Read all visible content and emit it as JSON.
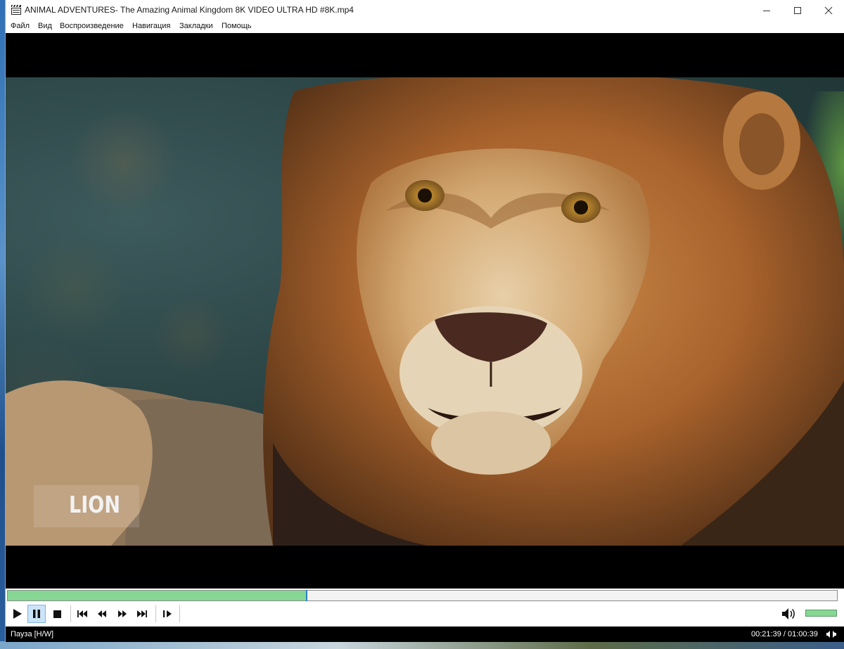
{
  "window": {
    "title": "ANIMAL ADVENTURES- The Amazing Animal Kingdom 8K VIDEO ULTRA HD #8K.mp4"
  },
  "menu": {
    "items": [
      "Файл",
      "Вид",
      "Воспроизведение",
      "Навигация",
      "Закладки",
      "Помощь"
    ]
  },
  "video": {
    "caption": "LION"
  },
  "playback": {
    "progress": 0.36,
    "volume": 1.0
  },
  "controls": {
    "icons": [
      "play-icon",
      "pause-icon",
      "stop-icon",
      "skip-previous-icon",
      "rewind-icon",
      "fast-forward-icon",
      "skip-next-icon",
      "frame-step-icon"
    ],
    "active": "pause"
  },
  "status": {
    "state": "Пауза [H/W]",
    "time": "00:21:39 / 01:00:39"
  },
  "colors": {
    "progress_fill": "#86d793",
    "thumb": "#2d7fd0"
  }
}
